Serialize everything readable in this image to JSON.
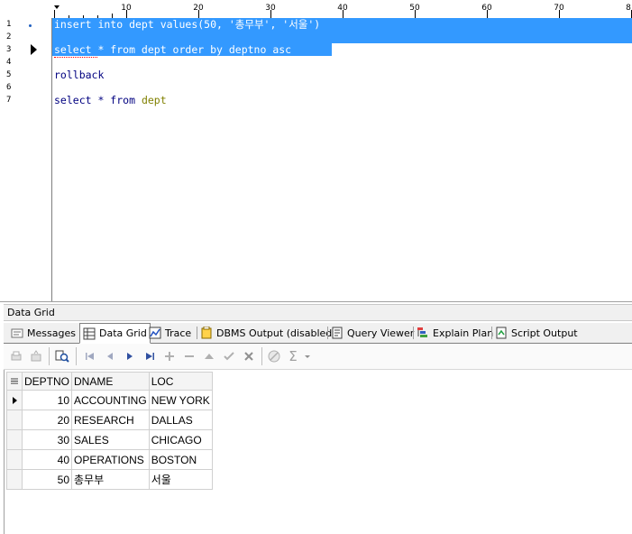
{
  "editor": {
    "ruler_labels": [
      "10",
      "20",
      "30",
      "40",
      "50",
      "60",
      "70",
      "8"
    ],
    "line_numbers": [
      "1",
      "2",
      "3",
      "4",
      "5",
      "6",
      "7"
    ],
    "lines": {
      "l1": "insert into dept values(50, '총무부', '서울')",
      "l3": "select * from dept order by deptno asc",
      "l5": "rollback",
      "l7_prefix": "select * from ",
      "l7_table": "dept"
    },
    "selection_color": "#3399ff"
  },
  "panel_title": "Data Grid",
  "tabs": [
    {
      "label": "Messages",
      "icon": "messages-icon"
    },
    {
      "label": "Data Grid",
      "icon": "data-grid-icon",
      "active": true
    },
    {
      "label": "Trace",
      "icon": "trace-icon"
    },
    {
      "label": "DBMS Output (disabled)",
      "icon": "dbms-output-icon"
    },
    {
      "label": "Query Viewer",
      "icon": "query-viewer-icon"
    },
    {
      "label": "Explain Plan",
      "icon": "explain-plan-icon"
    },
    {
      "label": "Script Output",
      "icon": "script-output-icon"
    }
  ],
  "toolbar": {
    "icons": [
      "print-icon",
      "export-icon",
      "find-icon",
      "first-record-icon",
      "prior-record-icon",
      "next-record-icon",
      "last-record-icon",
      "insert-record-icon",
      "delete-record-icon",
      "edit-record-icon",
      "post-edit-icon",
      "cancel-edit-icon",
      "refresh-icon",
      "sum-icon"
    ],
    "sum_symbol": "Σ"
  },
  "grid": {
    "columns": [
      "DEPTNO",
      "DNAME",
      "LOC"
    ],
    "rows": [
      {
        "deptno": "10",
        "dname": "ACCOUNTING",
        "loc": "NEW YORK"
      },
      {
        "deptno": "20",
        "dname": "RESEARCH",
        "loc": "DALLAS"
      },
      {
        "deptno": "30",
        "dname": "SALES",
        "loc": "CHICAGO"
      },
      {
        "deptno": "40",
        "dname": "OPERATIONS",
        "loc": "BOSTON"
      },
      {
        "deptno": "50",
        "dname": "총무부",
        "loc": "서울"
      }
    ]
  }
}
